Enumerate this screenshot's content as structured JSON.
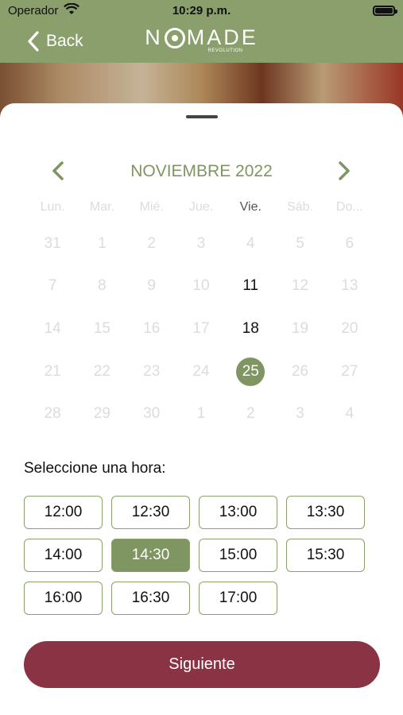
{
  "status_bar": {
    "carrier": "Operador",
    "time": "10:29 p.m."
  },
  "nav": {
    "back_label": "Back",
    "logo_pre": "N",
    "logo_post": "MADE",
    "logo_sub": "REVOLUTION"
  },
  "calendar": {
    "month_title": "NOVIEMBRE 2022",
    "weekdays": [
      "Lun.",
      "Mar.",
      "Mié.",
      "Jue.",
      "Vie.",
      "Sáb.",
      "Do..."
    ],
    "weeks": [
      [
        "31",
        "1",
        "2",
        "3",
        "4",
        "5",
        "6"
      ],
      [
        "7",
        "8",
        "9",
        "10",
        "11",
        "12",
        "13"
      ],
      [
        "14",
        "15",
        "16",
        "17",
        "18",
        "19",
        "20"
      ],
      [
        "21",
        "22",
        "23",
        "24",
        "25",
        "26",
        "27"
      ],
      [
        "28",
        "29",
        "30",
        "1",
        "2",
        "3",
        "4"
      ]
    ],
    "available_days": [
      "11",
      "18"
    ],
    "selected_day": "25"
  },
  "time_section": {
    "label": "Seleccione una hora:",
    "slots": [
      "12:00",
      "12:30",
      "13:00",
      "13:30",
      "14:00",
      "14:30",
      "15:00",
      "15:30",
      "16:00",
      "16:30",
      "17:00"
    ],
    "selected_slot": "14:30"
  },
  "next_button_label": "Siguiente",
  "colors": {
    "accent": "#7f9562",
    "nav_bg": "#8a9f6b",
    "primary_button": "#8a3345"
  }
}
